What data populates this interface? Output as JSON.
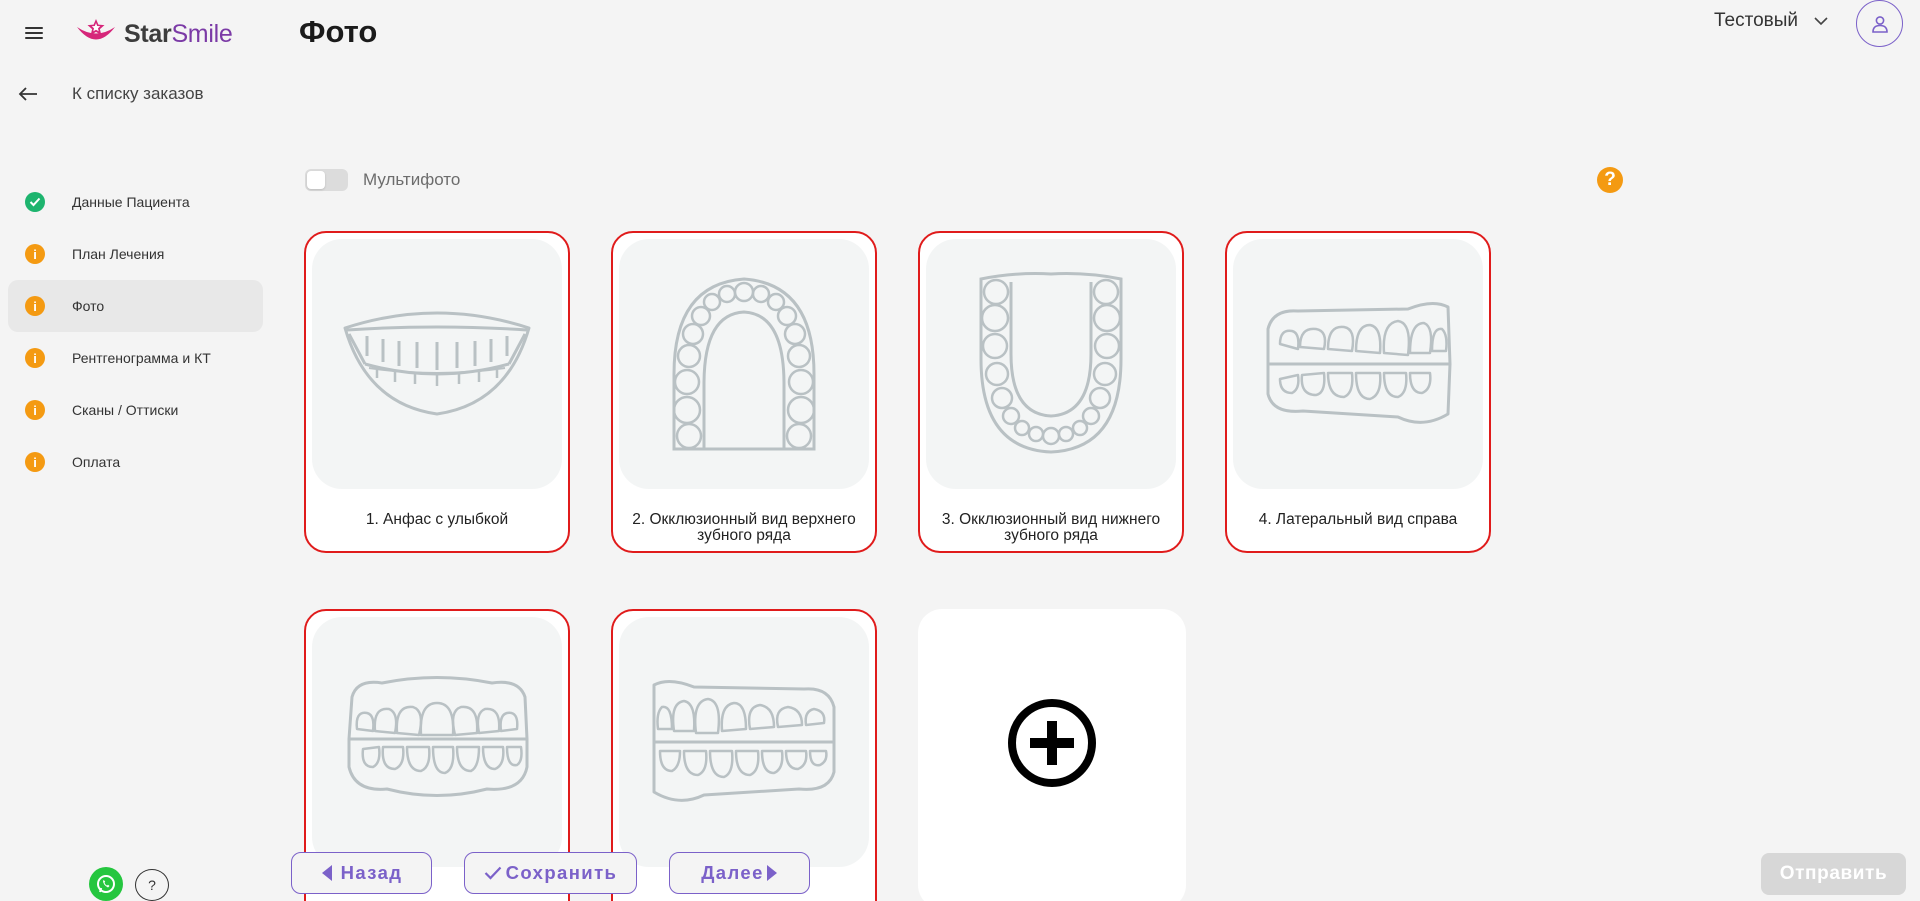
{
  "header": {
    "logo_text_1": "Star",
    "logo_text_2": "Smile",
    "page_title": "Фото",
    "user_name": "Тестовый"
  },
  "back_link": {
    "label": "К списку заказов"
  },
  "steps": [
    {
      "label": "Данные Пациента",
      "status": "done"
    },
    {
      "label": "План Лечения",
      "status": "warning"
    },
    {
      "label": "Фото",
      "status": "warning",
      "active": true
    },
    {
      "label": "Рентгенограмма и КТ",
      "status": "warning"
    },
    {
      "label": "Сканы / Оттиски",
      "status": "warning"
    },
    {
      "label": "Оплата",
      "status": "warning"
    }
  ],
  "multiphoto": {
    "label": "Мультифото",
    "enabled": false
  },
  "help_glyph": "?",
  "photos": [
    {
      "caption": "1. Анфас с улыбкой",
      "icon": "smile-icon"
    },
    {
      "caption": "2. Окклюзионный вид верхнего зубного ряда",
      "icon": "upper-arch-icon"
    },
    {
      "caption": "3. Окклюзионный вид нижнего зубного ряда",
      "icon": "lower-arch-icon"
    },
    {
      "caption": "4. Латеральный вид справа",
      "icon": "lateral-right-icon"
    },
    {
      "caption": "",
      "icon": "frontal-teeth-icon"
    },
    {
      "caption": "",
      "icon": "lateral-left-icon"
    }
  ],
  "buttons": {
    "back": "Назад",
    "save": "Сохранить",
    "next": "Далее",
    "send": "Отправить"
  },
  "colors": {
    "accent": "#7b61c9",
    "warning": "#f49a12",
    "done": "#1db46e",
    "card_border": "#e01b1b",
    "brand_pink": "#d6267a"
  }
}
